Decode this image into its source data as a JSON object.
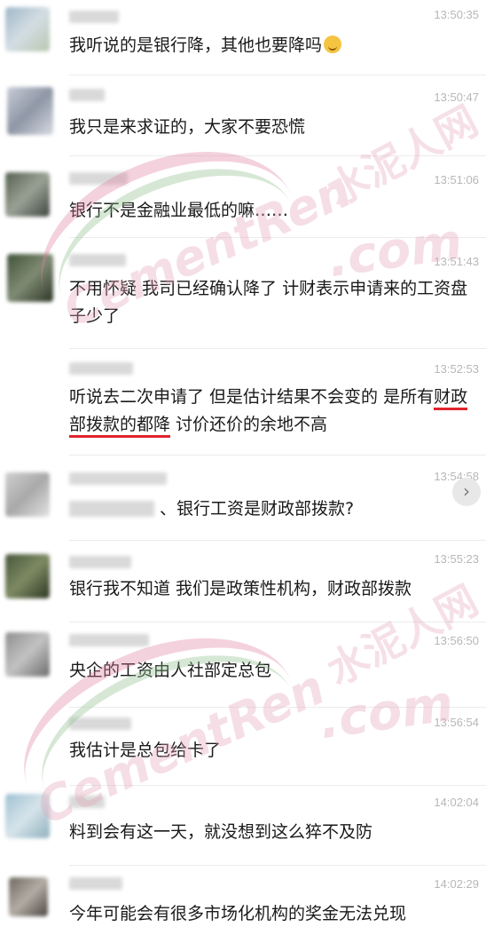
{
  "messages": [
    {
      "time": "13:50:35",
      "text": "我听说的是银行降，其他也要降吗",
      "emoji": "laughing-tears"
    },
    {
      "time": "13:50:47",
      "text": "我只是来求证的，大家不要恐慌"
    },
    {
      "time": "13:51:06",
      "text": "银行不是金融业最低的嘛……"
    },
    {
      "time": "13:51:43",
      "text": "不用怀疑 我司已经确认降了 计财表示申请来的工资盘子少了"
    },
    {
      "time": "13:52:53",
      "text_before": "听说去二次申请了 但是估计结果不会变的 是所有",
      "text_highlight": "财政部拨款的都降",
      "text_after": " 讨价还价的余地不高"
    },
    {
      "time": "13:54:58",
      "text": "、银行工资是财政部拨款?"
    },
    {
      "time": "13:55:23",
      "text": "银行我不知道 我们是政策性机构，财政部拨款"
    },
    {
      "time": "13:56:50",
      "text": "央企的工资由人社部定总包"
    },
    {
      "time": "13:56:54",
      "text": "我估计是总包给卡了"
    },
    {
      "time": "14:02:04",
      "text": "料到会有这一天，就没想到这么猝不及防"
    },
    {
      "time": "14:02:29",
      "text": "今年可能会有很多市场化机构的奖金无法兑现"
    }
  ],
  "watermark": {
    "brand_latin": "CementRen",
    "brand_cn": "水泥人网",
    "suffix": ".com"
  },
  "colors": {
    "highlight_underline": "#e0242b",
    "timestamp": "#b7b7b7",
    "text": "#1a1a1a"
  },
  "side_button_icon": "chevron-right-icon"
}
